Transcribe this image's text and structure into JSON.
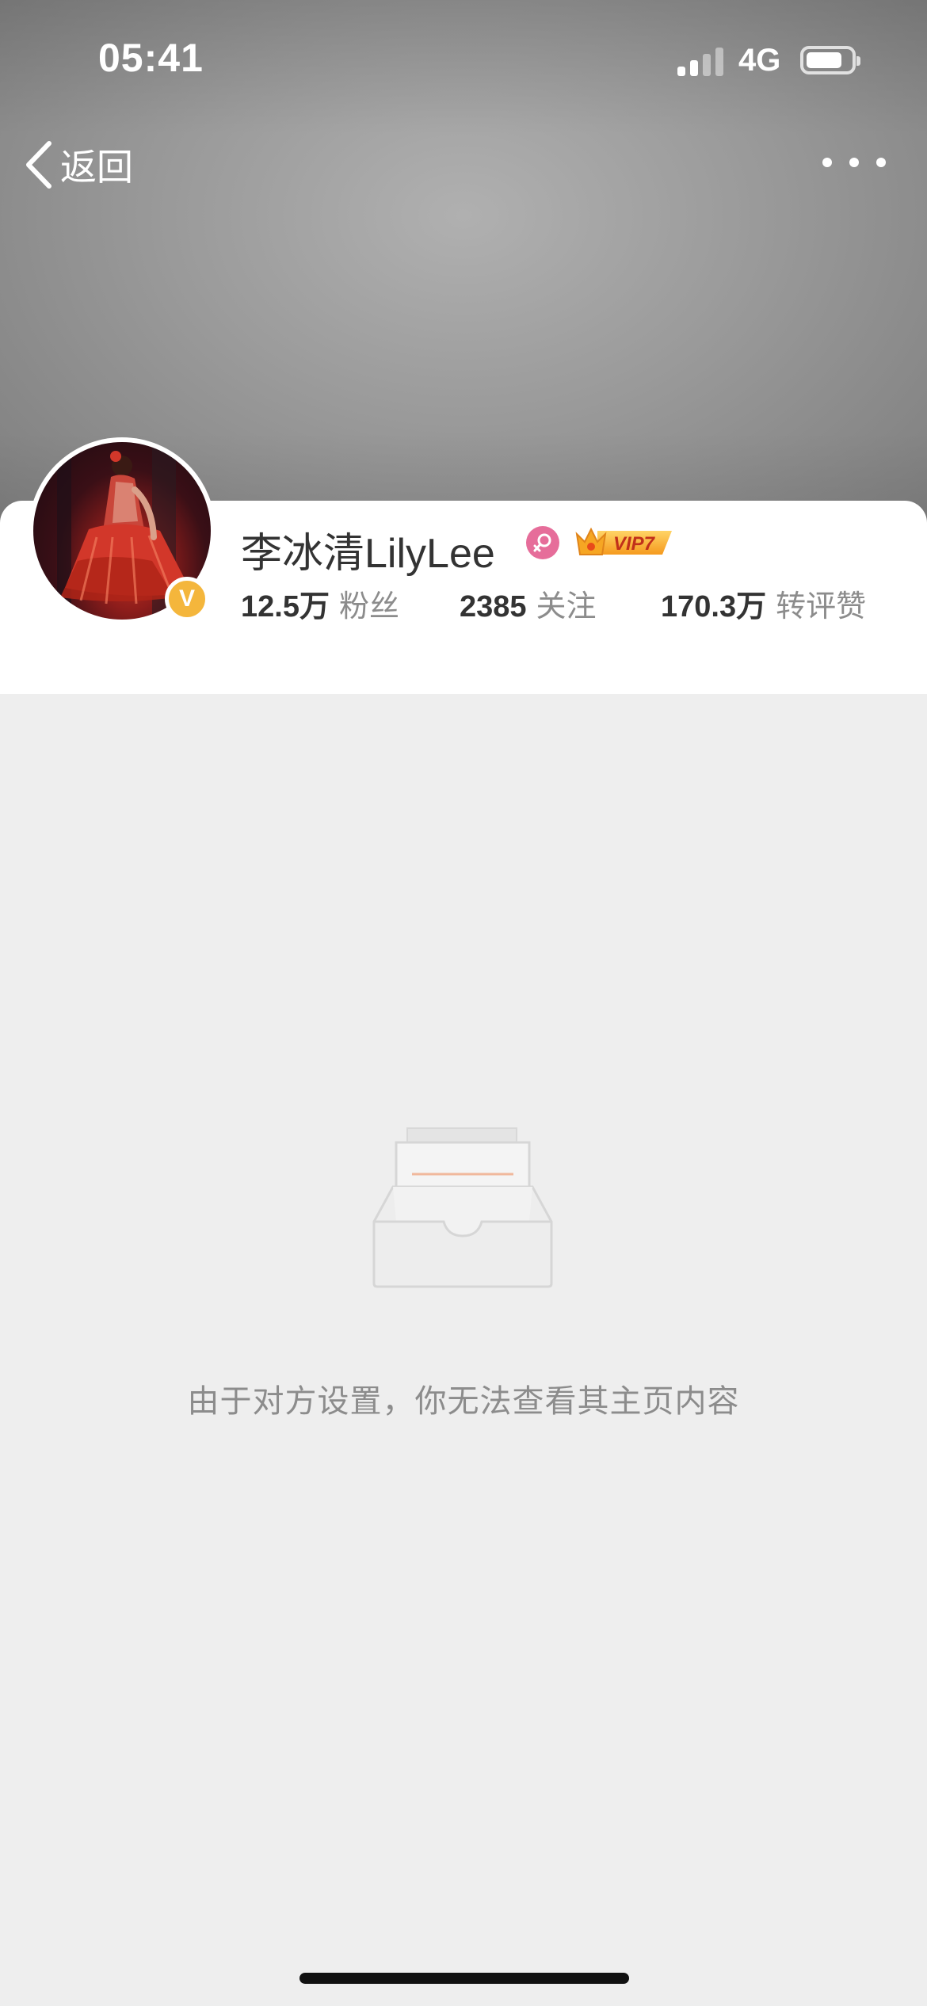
{
  "status_bar": {
    "time": "05:41",
    "network": "4G"
  },
  "nav": {
    "back_label": "返回",
    "back_icon": "chevron-left-icon",
    "more_icon": "more-dots-icon"
  },
  "profile": {
    "name": "李冰清LilyLee",
    "verified_icon": "V",
    "gender_icon": "female-icon",
    "gender_color": "#e66d9a",
    "vip_label": "VIP7",
    "stats": [
      {
        "value": "12.5万",
        "label": "粉丝"
      },
      {
        "value": "2385",
        "label": "关注"
      },
      {
        "value": "170.3万",
        "label": "转评赞"
      }
    ]
  },
  "empty_state": {
    "icon": "empty-inbox-icon",
    "message": "由于对方设置，你无法查看其主页内容"
  },
  "colors": {
    "background": "#eeeeee",
    "card": "#ffffff",
    "text_primary": "#333333",
    "text_secondary": "#8c8c8c",
    "verified": "#f4b63c",
    "vip": "#f5a623"
  }
}
